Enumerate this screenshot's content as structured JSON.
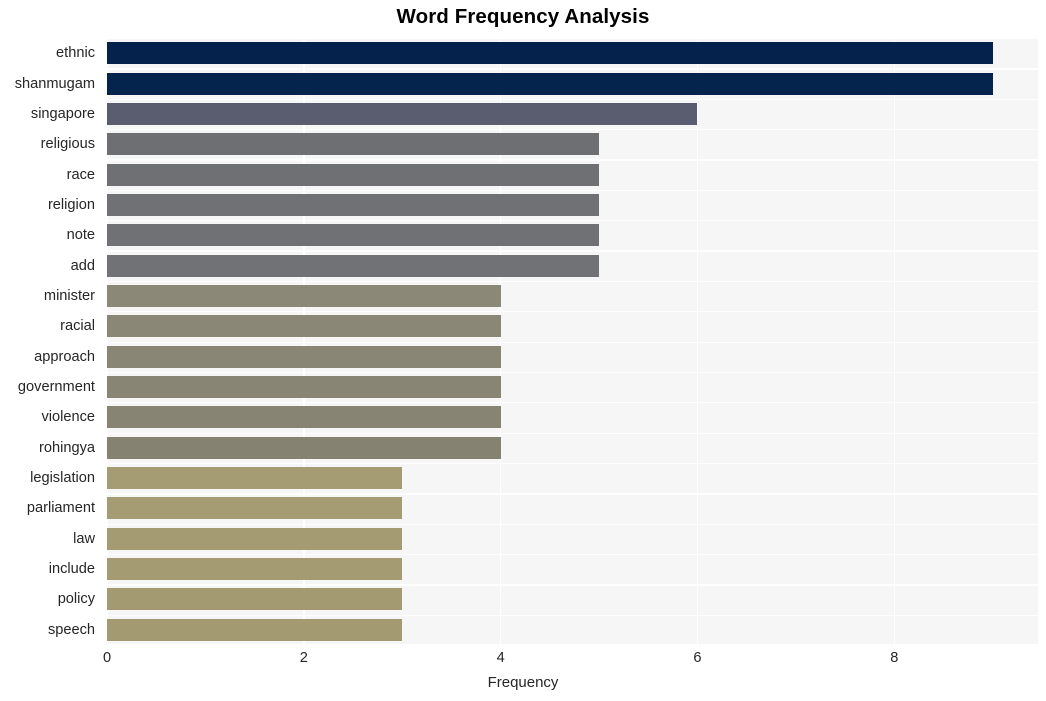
{
  "chart_data": {
    "type": "bar",
    "orientation": "horizontal",
    "title": "Word Frequency Analysis",
    "xlabel": "Frequency",
    "ylabel": "",
    "xlim": [
      0,
      9.46
    ],
    "ylim": null,
    "grid": true,
    "legend": null,
    "xticks": [
      0,
      2,
      4,
      6,
      8
    ],
    "xticklabels": [
      "0",
      "2",
      "4",
      "6",
      "8"
    ],
    "categories": [
      "ethnic",
      "shanmugam",
      "singapore",
      "religious",
      "race",
      "religion",
      "note",
      "add",
      "minister",
      "racial",
      "approach",
      "government",
      "violence",
      "rohingya",
      "legislation",
      "parliament",
      "law",
      "include",
      "policy",
      "speech"
    ],
    "values": [
      9,
      9,
      6,
      5,
      5,
      5,
      5,
      5,
      4,
      4,
      4,
      4,
      4,
      4,
      3,
      3,
      3,
      3,
      3,
      3
    ],
    "bar_colors": [
      "#04224c",
      "#04234d",
      "#5a5c70",
      "#6d6f72",
      "#6e7073",
      "#6f7174",
      "#707174",
      "#717275",
      "#8c8878",
      "#8b8777",
      "#8a8676",
      "#898575",
      "#888473",
      "#868271",
      "#a59c73",
      "#a59c73",
      "#a49b72",
      "#a49b72",
      "#a39a71",
      "#a39a71"
    ],
    "plot_bgcolor": "#f6f6f7",
    "gridline_color": "#ffffff",
    "text_color": "#262626",
    "title_color": "#000000"
  }
}
